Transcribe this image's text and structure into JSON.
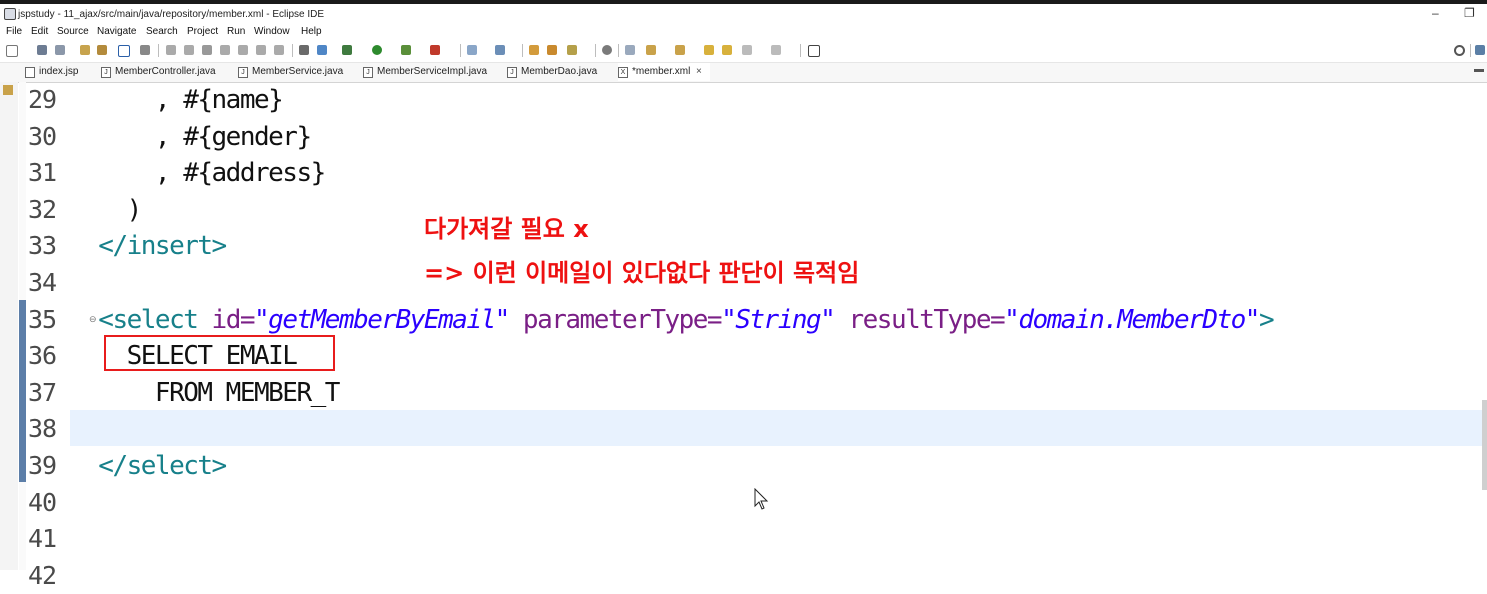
{
  "window": {
    "title": "jspstudy - 11_ajax/src/main/java/repository/member.xml - Eclipse IDE",
    "minimize": "–",
    "restore": "❐"
  },
  "menu": [
    "File",
    "Edit",
    "Source",
    "Navigate",
    "Search",
    "Project",
    "Run",
    "Window",
    "Help"
  ],
  "tabs": [
    {
      "label": "index.jsp",
      "icon": "file-icon"
    },
    {
      "label": "MemberController.java",
      "icon": "java-file-icon"
    },
    {
      "label": "MemberService.java",
      "icon": "java-file-icon"
    },
    {
      "label": "MemberServiceImpl.java",
      "icon": "java-file-icon"
    },
    {
      "label": "MemberDao.java",
      "icon": "java-file-icon"
    },
    {
      "label": "*member.xml",
      "icon": "xml-file-icon",
      "active": true,
      "close": "×"
    }
  ],
  "editor": {
    "line_numbers": [
      "29",
      "30",
      "31",
      "32",
      "33",
      "34",
      "35",
      "36",
      "37",
      "38",
      "39",
      "40",
      "41",
      "42"
    ],
    "lines": {
      "l29": "      , #{name}",
      "l30": "      , #{gender}",
      "l31": "      , #{address}",
      "l32": "    )",
      "l33_tag": "  </insert>",
      "l35_open": "  <select",
      "l35_id_attr": " id=",
      "l35_id_val": "\"getMemberByEmail\"",
      "l35_pt_attr": " parameterType=",
      "l35_pt_val": "\"String\"",
      "l35_rt_attr": " resultType=",
      "l35_rt_val": "\"domain.MemberDto\"",
      "l35_close": ">",
      "l36": "    SELECT EMAIL",
      "l37": "      FROM MEMBER_T",
      "l39_tag": "  </select>"
    },
    "current_line": "38"
  },
  "annotations": {
    "line1": "다가져갈 필요 x",
    "line2": "=> 이런 이메일이 있다없다 판단이 목적임"
  },
  "colors": {
    "annotation_red": "#ee1111",
    "xml_tag": "#17808a",
    "xml_attribute": "#7a1f86",
    "xml_value": "#2a00ff",
    "current_line_highlight": "#e8f2fe"
  }
}
